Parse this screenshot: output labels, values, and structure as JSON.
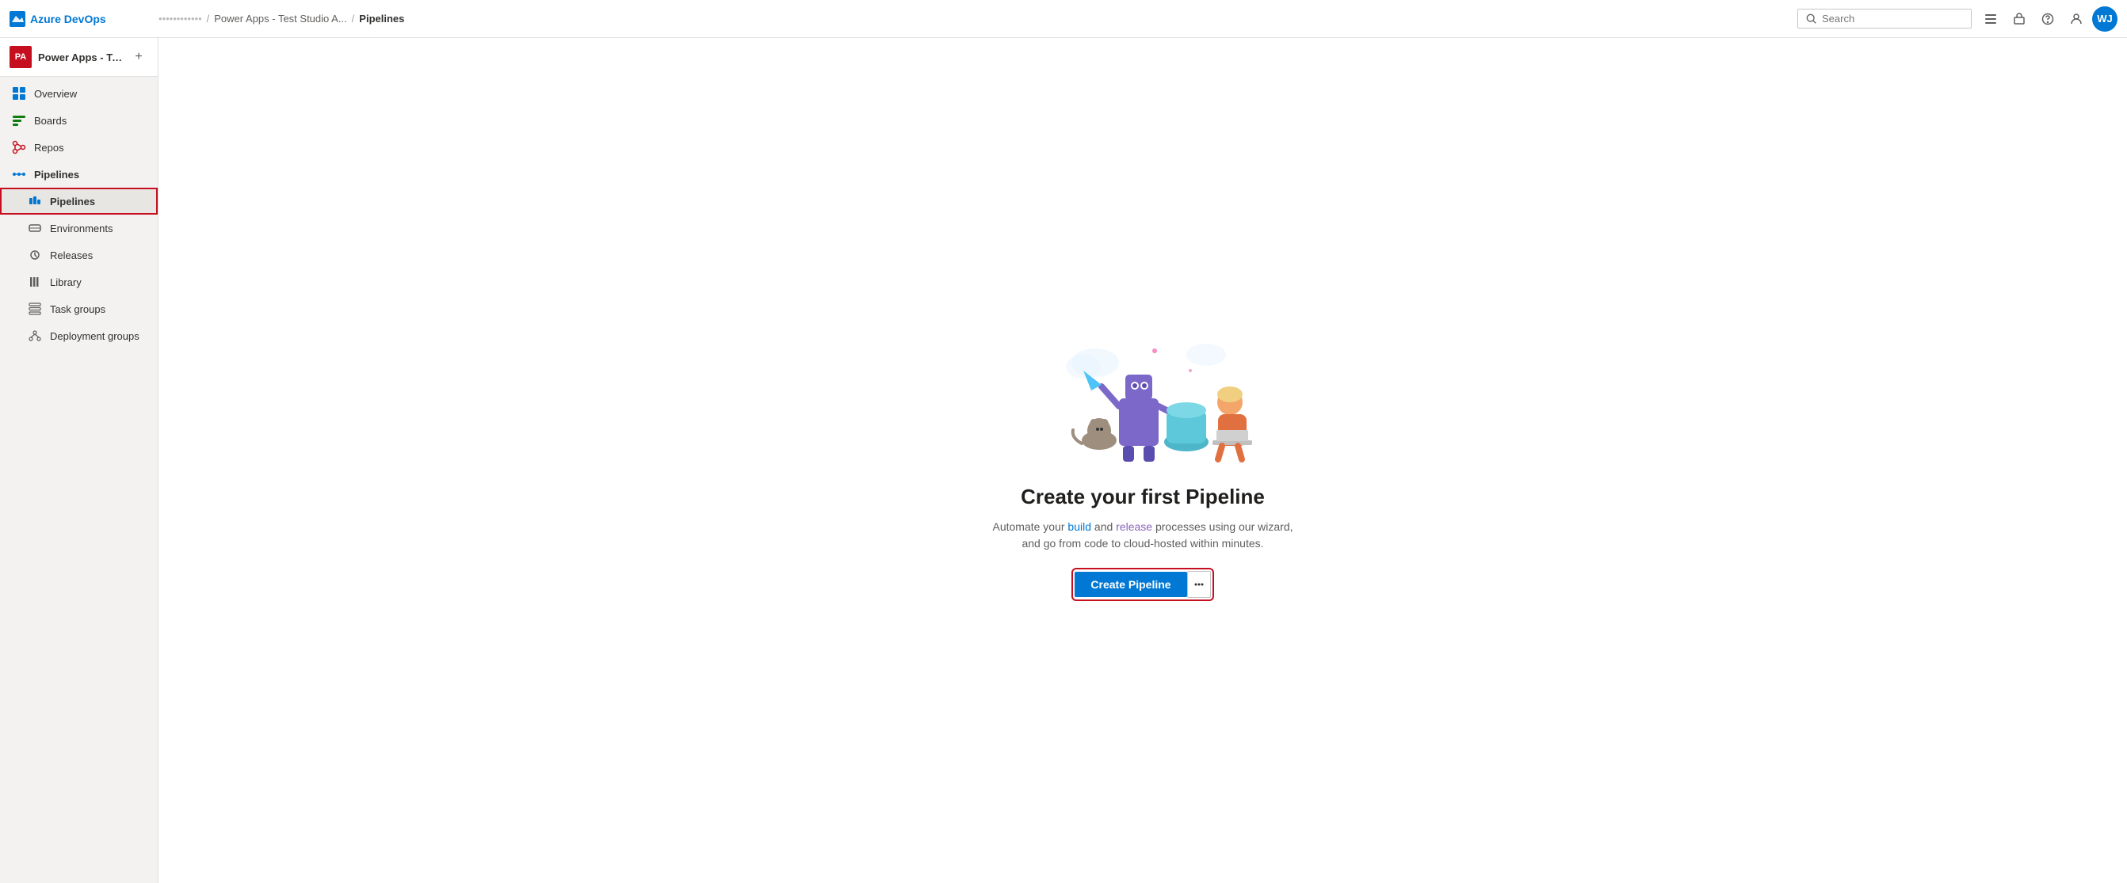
{
  "app": {
    "name": "Azure DevOps",
    "logo_color": "#0078d4"
  },
  "topbar": {
    "org_name": "••••••••••••",
    "breadcrumb": [
      {
        "label": "Power Apps - Test Studio A..."
      },
      {
        "label": "Pipelines"
      }
    ],
    "search_placeholder": "Search",
    "actions": {
      "settings_label": "Settings",
      "notifications_label": "Notifications",
      "help_label": "Help",
      "profile_label": "Profile",
      "avatar_initials": "WJ"
    }
  },
  "sidebar": {
    "project_icon": "PA",
    "project_name": "Power Apps - Test Stud...",
    "add_button_label": "+",
    "nav": {
      "overview_label": "Overview",
      "boards_label": "Boards",
      "repos_label": "Repos",
      "pipelines_section_label": "Pipelines",
      "pipelines_item_label": "Pipelines",
      "environments_label": "Environments",
      "releases_label": "Releases",
      "library_label": "Library",
      "task_groups_label": "Task groups",
      "deployment_groups_label": "Deployment groups"
    }
  },
  "main": {
    "hero": {
      "title": "Create your first Pipeline",
      "subtitle_part1": "Automate your build",
      "subtitle_link1": "build",
      "subtitle_part2": " and release processes using our wizard, and go from code to cloud-hosted within minutes.",
      "subtitle_full": "Automate your build and release processes using our wizard, and go from code to cloud-hosted within minutes.",
      "create_button_label": "Create Pipeline",
      "more_button_label": "···"
    }
  }
}
